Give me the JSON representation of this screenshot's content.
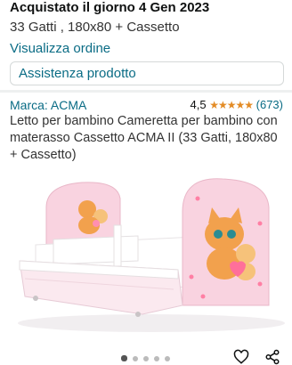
{
  "order": {
    "title": "Acquistato il giorno 4 Gen 2023",
    "variant": "33 Gatti , 180x80 + Cassetto",
    "view_order_link": "Visualizza ordine",
    "support_button": "Assistenza prodotto"
  },
  "product": {
    "brand": "Marca: ACMA",
    "rating_value": "4,5",
    "rating_stars": "★★★★★",
    "rating_count": "(673)",
    "description": "Letto per bambino Cameretta per bambino con materasso Cassetto ACMA II (33 Gatti, 180x80 + Cassetto)"
  },
  "gallery": {
    "current_index": 1,
    "total": 5
  },
  "icons": {
    "wishlist": "heart-icon",
    "share": "share-icon"
  },
  "colors": {
    "link": "#0a6c85",
    "star": "#e38b25",
    "bed_pink": "#f7c9d8"
  }
}
